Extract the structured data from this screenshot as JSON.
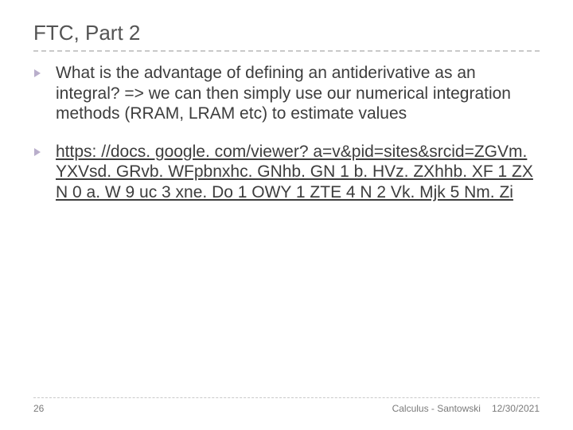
{
  "title": "FTC, Part 2",
  "bullets": [
    {
      "text": "What is the advantage of defining an antiderivative as an integral? => we can then simply use our numerical integration methods (RRAM, LRAM etc) to estimate values",
      "is_link": false
    },
    {
      "text": "https: //docs. google. com/viewer? a=v&pid=sites&srcid=ZGVm. YXVsd. GRvb. WFpbnxhc. GNhb. GN 1 b. HVz. ZXhhb. XF 1 ZXN 0 a. W 9 uc 3 xne. Do 1 OWY 1 ZTE 4 N 2 Vk. Mjk 5 Nm. Zi",
      "is_link": true
    }
  ],
  "footer": {
    "page": "26",
    "course": "Calculus - Santowski",
    "date": "12/30/2021"
  },
  "bullet_color": "#b9aecb"
}
